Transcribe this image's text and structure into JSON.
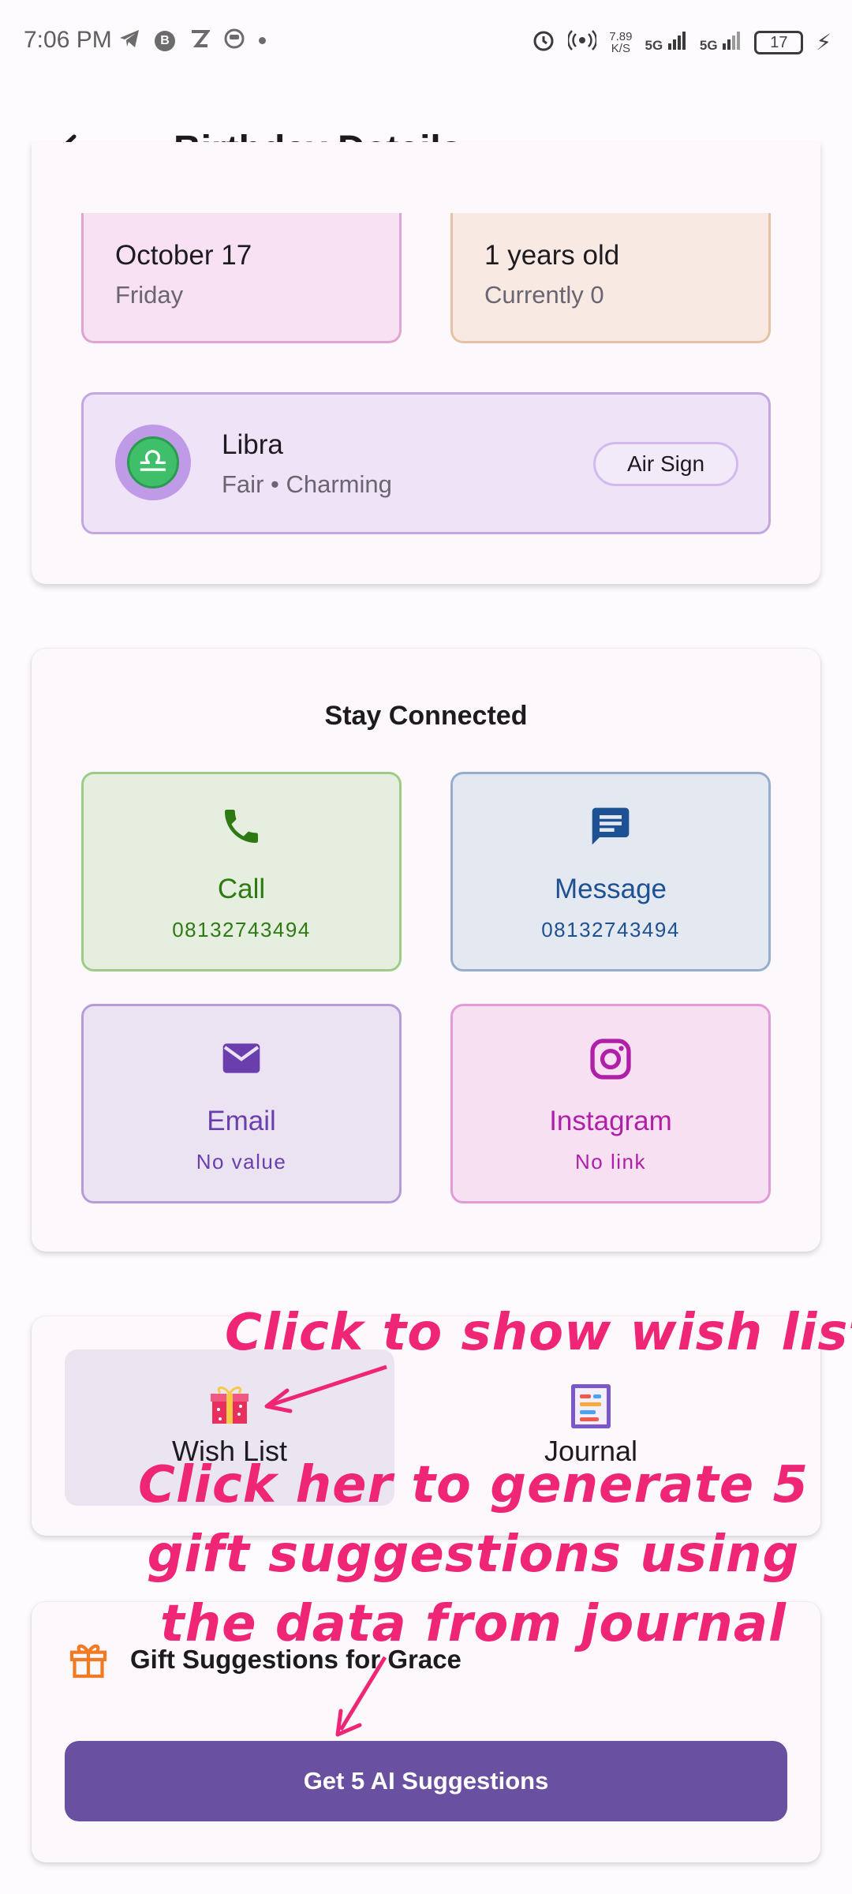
{
  "status_bar": {
    "time": "7:06 PM",
    "speed": "7.89",
    "speed_unit": "K/S",
    "network1": "5G",
    "network2": "5G",
    "battery": "17"
  },
  "app_bar": {
    "title": "Birthday Details",
    "back_icon": "arrow-left-icon"
  },
  "birthday": {
    "date": "October 17",
    "weekday": "Friday",
    "age": "1 years old",
    "age_sub": "Currently 0"
  },
  "zodiac": {
    "symbol": "♎",
    "name": "Libra",
    "traits": "Fair • Charming",
    "element": "Air Sign"
  },
  "connect": {
    "title": "Stay Connected",
    "call": {
      "label": "Call",
      "value": "08132743494",
      "icon": "phone-icon"
    },
    "message": {
      "label": "Message",
      "value": "08132743494",
      "icon": "message-icon"
    },
    "email": {
      "label": "Email",
      "value": "No value",
      "icon": "mail-icon"
    },
    "instagram": {
      "label": "Instagram",
      "value": "No link",
      "icon": "instagram-icon"
    }
  },
  "tabs": {
    "wish_list": "Wish List",
    "journal": "Journal"
  },
  "gift": {
    "title": "Gift Suggestions for Grace",
    "button": "Get 5 AI Suggestions"
  },
  "annotations": {
    "wish": "Click to show wish list",
    "ai": "Click her to generate 5 gift suggestions using the data from journal"
  },
  "colors": {
    "primary": "#6950a1",
    "annotation": "#ef2576",
    "call": "#2e7a12",
    "message": "#1e5194",
    "email": "#6a3fad",
    "instagram": "#b01fa8"
  }
}
